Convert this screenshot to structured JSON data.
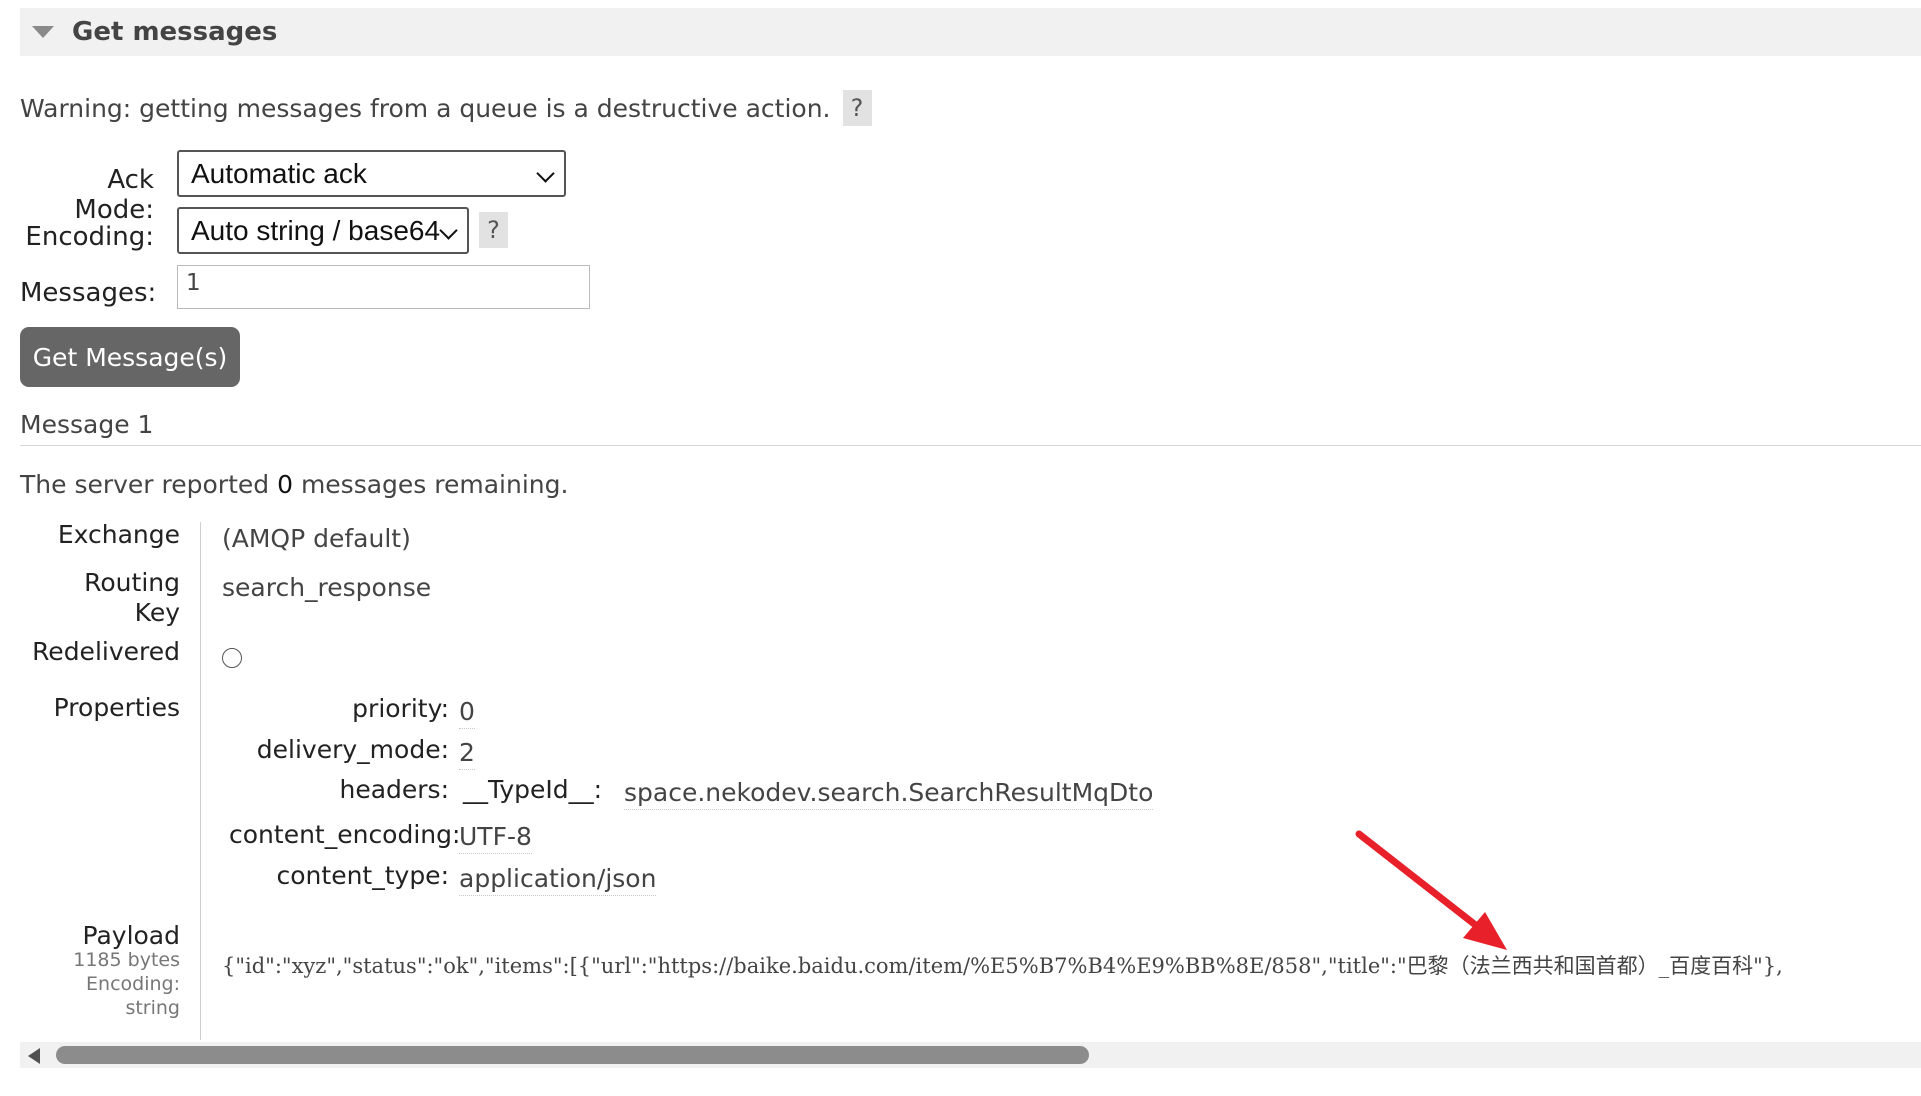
{
  "section": {
    "title": "Get messages"
  },
  "warning": {
    "text": "Warning: getting messages from a queue is a destructive action.",
    "help": "?"
  },
  "form": {
    "ack_mode": {
      "label": "Ack Mode:",
      "value": "Automatic ack"
    },
    "encoding": {
      "label": "Encoding:",
      "value": "Auto string / base64",
      "help": "?"
    },
    "messages": {
      "label": "Messages:",
      "value": "1"
    },
    "button": "Get Message(s)"
  },
  "message": {
    "heading": "Message 1",
    "remaining_prefix": "The server reported",
    "remaining_count": "0",
    "remaining_suffix": "messages remaining.",
    "exchange": {
      "label": "Exchange",
      "value": "(AMQP default)"
    },
    "routing_key": {
      "label_line1": "Routing",
      "label_line2": "Key",
      "value": "search_response"
    },
    "redelivered": {
      "label": "Redelivered"
    },
    "properties": {
      "label": "Properties",
      "priority": {
        "key": "priority:",
        "value": "0"
      },
      "delivery_mode": {
        "key": "delivery_mode:",
        "value": "2"
      },
      "headers": {
        "key": "headers:",
        "header_key": "__TypeId__:",
        "header_value": "space.nekodev.search.SearchResultMqDto"
      },
      "content_encoding": {
        "key": "content_encoding:",
        "value": "UTF-8"
      },
      "content_type": {
        "key": "content_type:",
        "value": "application/json"
      }
    },
    "payload": {
      "label": "Payload",
      "size": "1185 bytes",
      "encoding_label": "Encoding:",
      "encoding_value": "string",
      "text": "{\"id\":\"xyz\",\"status\":\"ok\",\"items\":[{\"url\":\"https://baike.baidu.com/item/%E5%B7%B4%E9%BB%8E/858\",\"title\":\"巴黎（法兰西共和国首都）_百度百科\"},"
    }
  },
  "colors": {
    "button_bg": "#666666",
    "annotation_arrow": "#e8202a"
  }
}
